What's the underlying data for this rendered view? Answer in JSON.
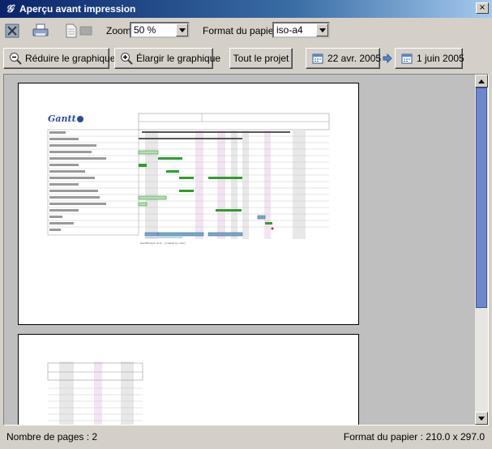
{
  "window": {
    "title": "Aperçu avant impression",
    "close_glyph": "×",
    "app_icon": "gantt-app-icon"
  },
  "toolbar": {
    "zoom_label": "Zoom",
    "zoom_value": "50 %",
    "format_label": "Format du papier",
    "format_value": "iso-a4",
    "icons": [
      "close-preview-icon",
      "print-icon",
      "page-icon",
      "page-gray-icon"
    ]
  },
  "buttons": {
    "reduce": "Réduire le graphique",
    "enlarge": "Élargir le graphique",
    "whole_project": "Tout le projet",
    "start_date": "22 avr. 2005",
    "end_date": "1 juin 2005"
  },
  "preview": {
    "logo_text": "Gantt",
    "footer_text": "GanttProject (2.0) - [created by user]",
    "colors": {
      "bar_green": "#2e9e2e",
      "bar_blue": "#7aa7c7",
      "weekend_gray": "#e6e6e6",
      "weekend_pink": "#f1e0f1",
      "milestone_red": "#e02020"
    }
  },
  "status": {
    "pages": "Nombre de pages :  2",
    "paper": "Format du papier :  210.0 x 297.0"
  }
}
